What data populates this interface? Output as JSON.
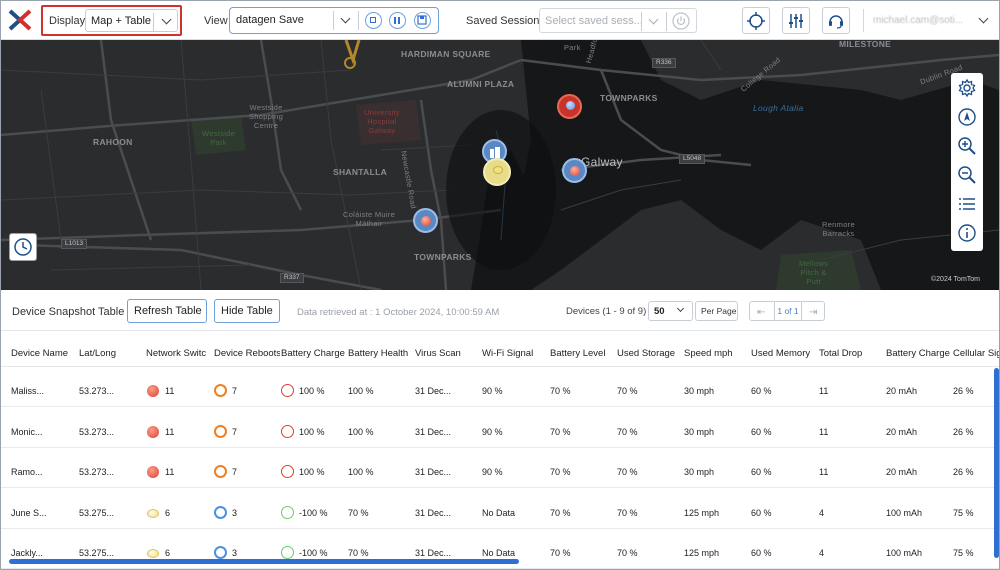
{
  "toolbar": {
    "display_label": "Display",
    "display_value": "Map + Table",
    "view_label": "View",
    "view_value": "datagen Save",
    "saved_sessions_label": "Saved Sessions",
    "saved_sessions_placeholder": "Select saved sess...",
    "user_name": "michael.cam@soti..."
  },
  "map": {
    "labels": {
      "hardiman": "HARDIMAN SQUARE",
      "alumni": "ALUMNI PLAZA",
      "townparks_top": "TOWNPARKS",
      "townparks_bottom": "TOWNPARKS",
      "rahoon": "RAHOON",
      "shantalla": "SHANTALLA",
      "milestone": "MILESTONE",
      "galway": "Galway",
      "lough": "Lough Atalia",
      "westside": "Westside\nShopping\nCentre",
      "westside_park": "Westside\nPark",
      "hospital": "University\nHospital\nGalway",
      "colaiste": "Coláiste Muire\nMáthair",
      "renmore": "Renmore\nBarracks",
      "mellows": "Mellows\nPitch &\nPutt",
      "park_top": "Park",
      "newcastle": "Newcastle Road",
      "headford": "Headford",
      "dublin": "Dublin Road",
      "college": "College Road"
    },
    "road_badges": {
      "r336": "R336",
      "l5048": "L5048",
      "l1013": "L1013",
      "r337": "R337"
    },
    "copyright": "©2024 TomTom"
  },
  "table_bar": {
    "title": "Device Snapshot Table",
    "refresh_label": "Refresh Table",
    "hide_label": "Hide Table",
    "retrieved": "Data retrieved at : 1 October 2024, 10:00:59 AM",
    "device_count": "Devices (1 - 9 of 9)",
    "per_page_value": "50",
    "per_page_label": "Per Page",
    "page_indicator": "1 of 1"
  },
  "columns": [
    "Device Name",
    "Lat/Long",
    "Network Switc",
    "Device Reboots",
    "Battery Charge",
    "Battery Health",
    "Virus Scan",
    "Wi-Fi Signal",
    "Battery Level",
    "Used Storage",
    "Speed mph",
    "Used Memory",
    "Total Drop",
    "Battery Charge",
    "Cellular Sig"
  ],
  "rows": [
    {
      "name": "Maliss...",
      "latlong": "53.273...",
      "network": "11",
      "reboots": "7",
      "battery_charge": "100 %",
      "battery_health": "100 %",
      "virus_scan": "31 Dec...",
      "wifi": "90 %",
      "battery_level": "70 %",
      "used_storage": "70 %",
      "speed": "30 mph",
      "used_memory": "60 %",
      "total_drop": "11",
      "battery_charge2": "20 mAh",
      "cellular": "26 %",
      "status": "red"
    },
    {
      "name": "Monic...",
      "latlong": "53.273...",
      "network": "11",
      "reboots": "7",
      "battery_charge": "100 %",
      "battery_health": "100 %",
      "virus_scan": "31 Dec...",
      "wifi": "90 %",
      "battery_level": "70 %",
      "used_storage": "70 %",
      "speed": "30 mph",
      "used_memory": "60 %",
      "total_drop": "11",
      "battery_charge2": "20 mAh",
      "cellular": "26 %",
      "status": "red"
    },
    {
      "name": "Ramo...",
      "latlong": "53.273...",
      "network": "11",
      "reboots": "7",
      "battery_charge": "100 %",
      "battery_health": "100 %",
      "virus_scan": "31 Dec...",
      "wifi": "90 %",
      "battery_level": "70 %",
      "used_storage": "70 %",
      "speed": "30 mph",
      "used_memory": "60 %",
      "total_drop": "11",
      "battery_charge2": "20 mAh",
      "cellular": "26 %",
      "status": "red"
    },
    {
      "name": "June S...",
      "latlong": "53.275...",
      "network": "6",
      "reboots": "3",
      "battery_charge": "-100 %",
      "battery_health": "70 %",
      "virus_scan": "31 Dec...",
      "wifi": "No Data",
      "battery_level": "70 %",
      "used_storage": "70 %",
      "speed": "125 mph",
      "used_memory": "60 %",
      "total_drop": "4",
      "battery_charge2": "100 mAh",
      "cellular": "75 %",
      "status": "yellow"
    },
    {
      "name": "Jackly...",
      "latlong": "53.275...",
      "network": "6",
      "reboots": "3",
      "battery_charge": "-100 %",
      "battery_health": "70 %",
      "virus_scan": "31 Dec...",
      "wifi": "No Data",
      "battery_level": "70 %",
      "used_storage": "70 %",
      "speed": "125 mph",
      "used_memory": "60 %",
      "total_drop": "4",
      "battery_charge2": "100 mAh",
      "cellular": "75 %",
      "status": "yellow"
    }
  ],
  "colors": {
    "accent": "#6fa0d6",
    "highlight": "#d0312d",
    "scroll": "#2f6fd4",
    "status_red": "#d9412f",
    "status_yellow": "#f3e08a",
    "ring_orange": "#f07f1e",
    "ring_red": "#d9412f",
    "ring_blue": "#4a90e2",
    "ring_green": "#66cc66"
  }
}
